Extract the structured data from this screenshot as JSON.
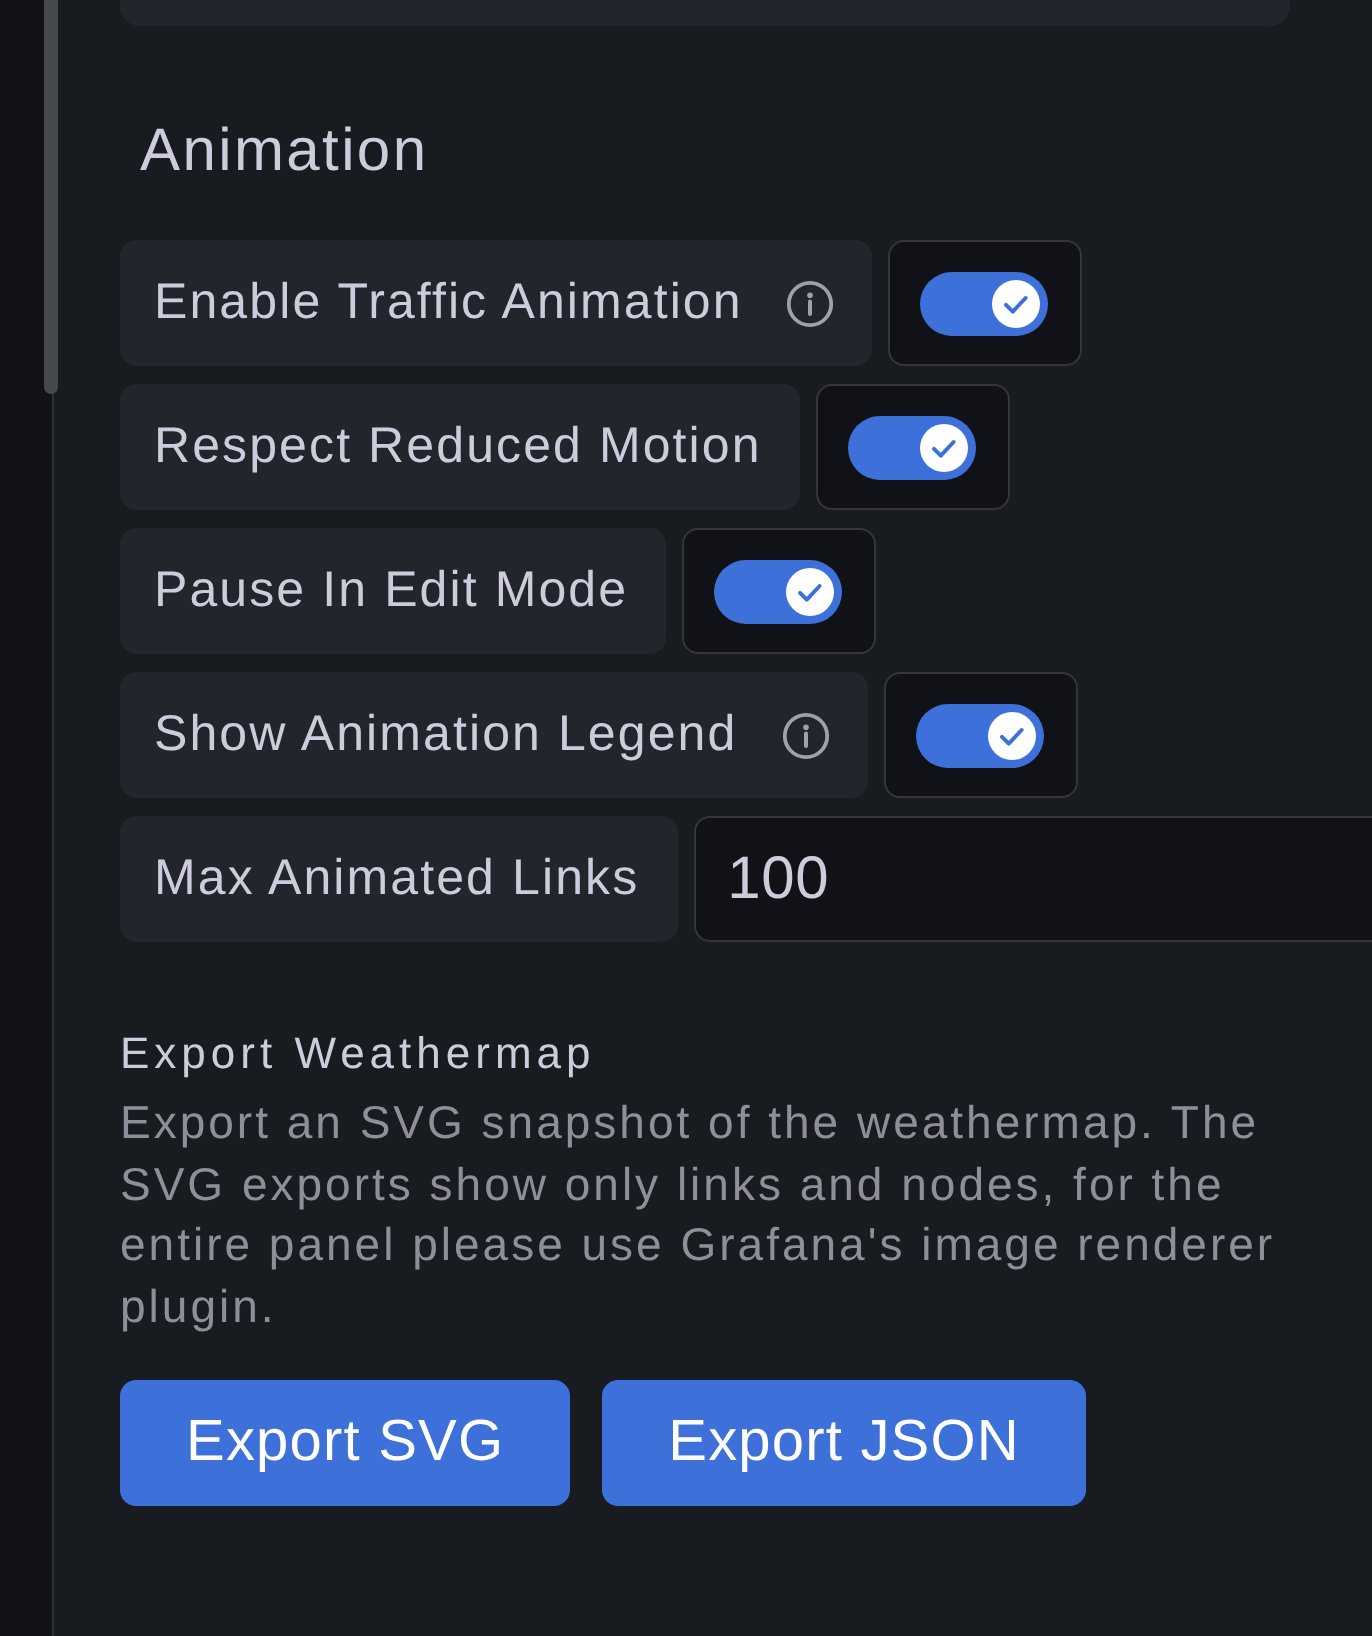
{
  "section": {
    "title": "Animation"
  },
  "options": [
    {
      "kind": "toggle",
      "label": "Enable Traffic Animation",
      "info": true,
      "on": true
    },
    {
      "kind": "toggle",
      "label": "Respect Reduced Motion",
      "info": false,
      "on": true
    },
    {
      "kind": "toggle",
      "label": "Pause In Edit Mode",
      "info": false,
      "on": true
    },
    {
      "kind": "toggle",
      "label": "Show Animation Legend",
      "info": true,
      "on": true
    },
    {
      "kind": "number",
      "label": "Max Animated Links",
      "value": "100"
    }
  ],
  "export": {
    "title": "Export Weathermap",
    "description": "Export an SVG snapshot of the weathermap. The SVG exports show only links and nodes, for the entire panel please use Grafana's image renderer plugin.",
    "buttons": [
      "Export SVG",
      "Export JSON"
    ]
  }
}
